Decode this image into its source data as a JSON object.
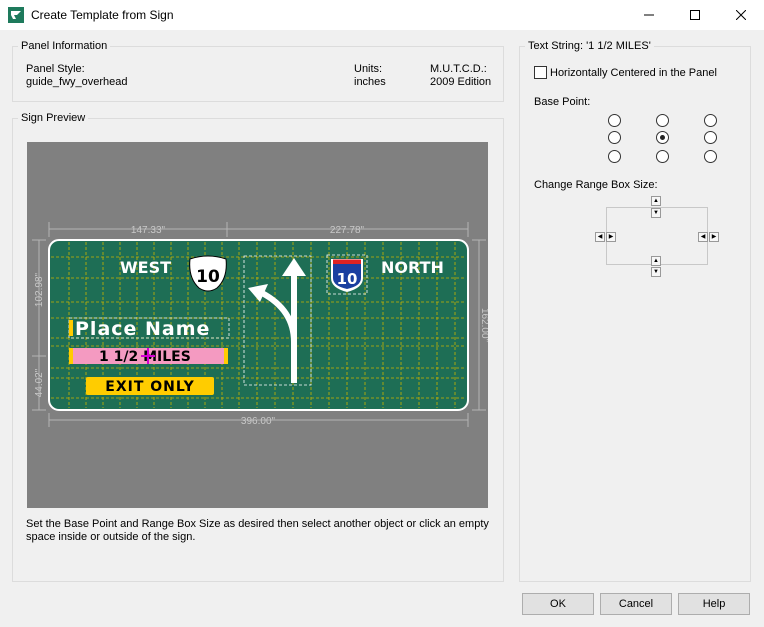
{
  "window": {
    "title": "Create Template from Sign",
    "minimize_icon": "minimize-icon",
    "maximize_icon": "maximize-icon",
    "close_icon": "close-icon"
  },
  "panel_info": {
    "group_title": "Panel Information",
    "style_label": "Panel Style:",
    "style_value": "guide_fwy_overhead",
    "units_label": "Units:",
    "units_value": "inches",
    "mutcd_label": "M.U.T.C.D.:",
    "mutcd_value": "2009 Edition"
  },
  "sign_preview": {
    "group_title": "Sign Preview",
    "dim_top_left": "147.33\"",
    "dim_top_right": "227.78\"",
    "dim_bottom": "396.00\"",
    "dim_left_top": "102.98\"",
    "dim_left_bottom": "44.02\"",
    "dim_right": "162.00\"",
    "text_west": "WEST",
    "text_north": "NORTH",
    "shield_us": "10",
    "shield_interstate": "10",
    "shield_interstate_top": "INTERSTATE",
    "text_place": "Place Name",
    "text_distance": "1 1/2 MILES",
    "text_exit": "EXIT ONLY",
    "instructions": "Set the Base Point and Range Box Size as desired then select another object or click an empty space inside or outside of the sign.",
    "colors": {
      "sign_green": "#1e6e55",
      "exit_yellow": "#ffcc00",
      "highlight_pink": "#f49ac1",
      "crosshair": "#d400d4"
    }
  },
  "text_string": {
    "group_title": "Text String: '1 1/2 MILES'",
    "centered_label": "Horizontally Centered in the Panel",
    "centered_checked": false,
    "base_point_label": "Base Point:",
    "base_point_selected": "center",
    "range_box_label": "Change Range Box Size:"
  },
  "buttons": {
    "ok": "OK",
    "cancel": "Cancel",
    "help": "Help"
  }
}
